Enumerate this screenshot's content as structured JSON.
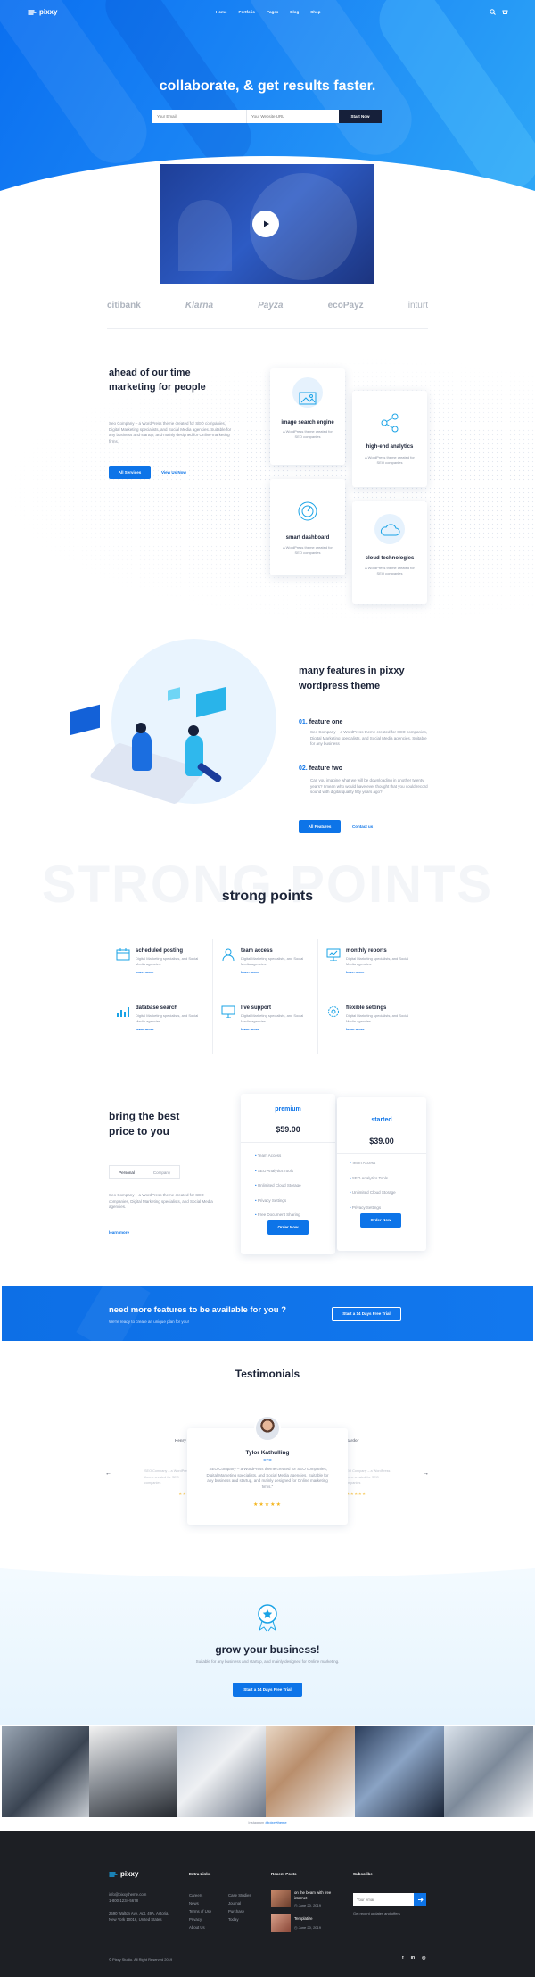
{
  "header": {
    "logo": "pixxy",
    "nav": [
      "Home",
      "Portfolio",
      "Pages",
      "Blog",
      "Shop"
    ]
  },
  "hero": {
    "title": "collaborate, & get results faster.",
    "email_placeholder": "Your Email",
    "website_placeholder": "Your Website URL",
    "cta": "Start Now"
  },
  "clients": [
    "citibank",
    "Klarna",
    "Payza",
    "ecoPayz",
    "inturt"
  ],
  "about": {
    "title_line1": "ahead of our time",
    "title_line2": "marketing for people",
    "desc": "Seo Company – a WordPress theme created for SEO companies, Digital Marketing specialists, and Social Media agencies. Suitable for any business and startup, and mainly designed for Online marketing firms.",
    "btn_primary": "All Services",
    "btn_link": "View Us Now",
    "services": [
      {
        "title": "image search engine",
        "desc": "A WordPress theme created for SEO companies"
      },
      {
        "title": "high-end analytics",
        "desc": "A WordPress theme created for SEO companies"
      },
      {
        "title": "smart dashboard",
        "desc": "A WordPress theme created for SEO companies"
      },
      {
        "title": "cloud technologies",
        "desc": "A WordPress theme created for SEO companies"
      }
    ]
  },
  "features": {
    "title_line1": "many features in pixxy",
    "title_line2": "wordpress theme",
    "items": [
      {
        "num": "01.",
        "title": "feature one",
        "desc": "Seo Company – a WordPress theme created for SEO companies, Digital Marketing specialists, and Social Media agencies. Suitable for any business"
      },
      {
        "num": "02.",
        "title": "feature two",
        "desc": "Can you imagine what we will be downloading in another twenty years? I mean who would have ever thought that you could record sound with digital quality fifty years ago?"
      }
    ],
    "btn_primary": "All Features",
    "btn_link": "Contact us"
  },
  "strong": {
    "watermark": "STRONG POINTS",
    "title": "strong points",
    "items": [
      {
        "title": "scheduled posting",
        "desc": "Digital Marketing specialists, and Social Media agencies.",
        "link": "learn more"
      },
      {
        "title": "team access",
        "desc": "Digital Marketing specialists, and Social Media agencies.",
        "link": "learn more"
      },
      {
        "title": "monthly reports",
        "desc": "Digital Marketing specialists, and Social Media agencies.",
        "link": "learn more"
      },
      {
        "title": "database search",
        "desc": "Digital Marketing specialists, and Social Media agencies.",
        "link": "learn more"
      },
      {
        "title": "live support",
        "desc": "Digital Marketing specialists, and Social Media agencies.",
        "link": "learn more"
      },
      {
        "title": "flexible settings",
        "desc": "Digital Marketing specialists, and Social Media agencies.",
        "link": "learn more"
      }
    ]
  },
  "pricing": {
    "title_line1": "bring the best",
    "title_line2": "price to you",
    "tab_personal": "Personal",
    "tab_company": "Company",
    "desc": "Seo Company – a WordPress theme created for SEO companies, Digital Marketing specialists, and Social Media agencies.",
    "link": "learn more",
    "plans": [
      {
        "name": "premium",
        "price": "$59.00",
        "features": [
          "Team Access",
          "SEO Analytics Tools",
          "Unlimited Cloud Storage",
          "Privacy Settings",
          "Free Document Sharing"
        ],
        "cta": "Order Now"
      },
      {
        "name": "started",
        "price": "$39.00",
        "features": [
          "Team Access",
          "SEO Analytics Tools",
          "Unlimited Cloud Storage",
          "Privacy Settings"
        ],
        "cta": "Order Now"
      }
    ]
  },
  "cta_band": {
    "title": "need more features to be available for you ?",
    "sub": "We're ready to create an unique plan for you!",
    "btn": "Start a 14 Days Free Trial"
  },
  "testimonials": {
    "title": "Testimonials",
    "name": "Tylor Kathulling",
    "role": "CTO",
    "quote": "\"SEO Company – a WordPress theme created for SEO companies, Digital Marketing specialists, and Social Media agencies. Suitable for any business and startup, and mainly designed for Online marketing firms.\"",
    "stars": "★★★★★",
    "left_name": "Henry C.",
    "right_name": "Sardor",
    "side_text": "SEO Company – a WordPress theme created for SEO companies"
  },
  "grow": {
    "title": "grow your business!",
    "desc": "Suitable for any business and startup, and mainly designed for Online marketing.",
    "btn": "Start a 14 Days Free Trial"
  },
  "instagram": {
    "label": "Instagram",
    "handle": "@pixxytheme"
  },
  "footer": {
    "logo": "pixxy",
    "email": "info@pixxytheme.com",
    "phone": "1-800-1234-5678",
    "address_line1": "2590 Walton Ave, Apt. 49A, Astoria,",
    "address_line2": "New York 10016, United States",
    "links_title": "Extra Links",
    "links_col1": [
      "Careers",
      "News",
      "Terms of Use",
      "Privacy",
      "About Us"
    ],
    "links_col2": [
      "Case Studies",
      "Journal",
      "Purchase",
      "Today"
    ],
    "recent_title": "Recent Posts",
    "posts": [
      {
        "title": "on the beam with free internet",
        "date": "June 20, 2019"
      },
      {
        "title": "Templatize",
        "date": "June 20, 2019"
      }
    ],
    "subscribe_title": "Subscribe",
    "subscribe_placeholder": "Your email",
    "subscribe_note": "Get recent updates and offers",
    "copyright": "© Pixxy Studio. All Right Reserved 2019",
    "social": [
      "f",
      "in",
      "◎"
    ]
  }
}
